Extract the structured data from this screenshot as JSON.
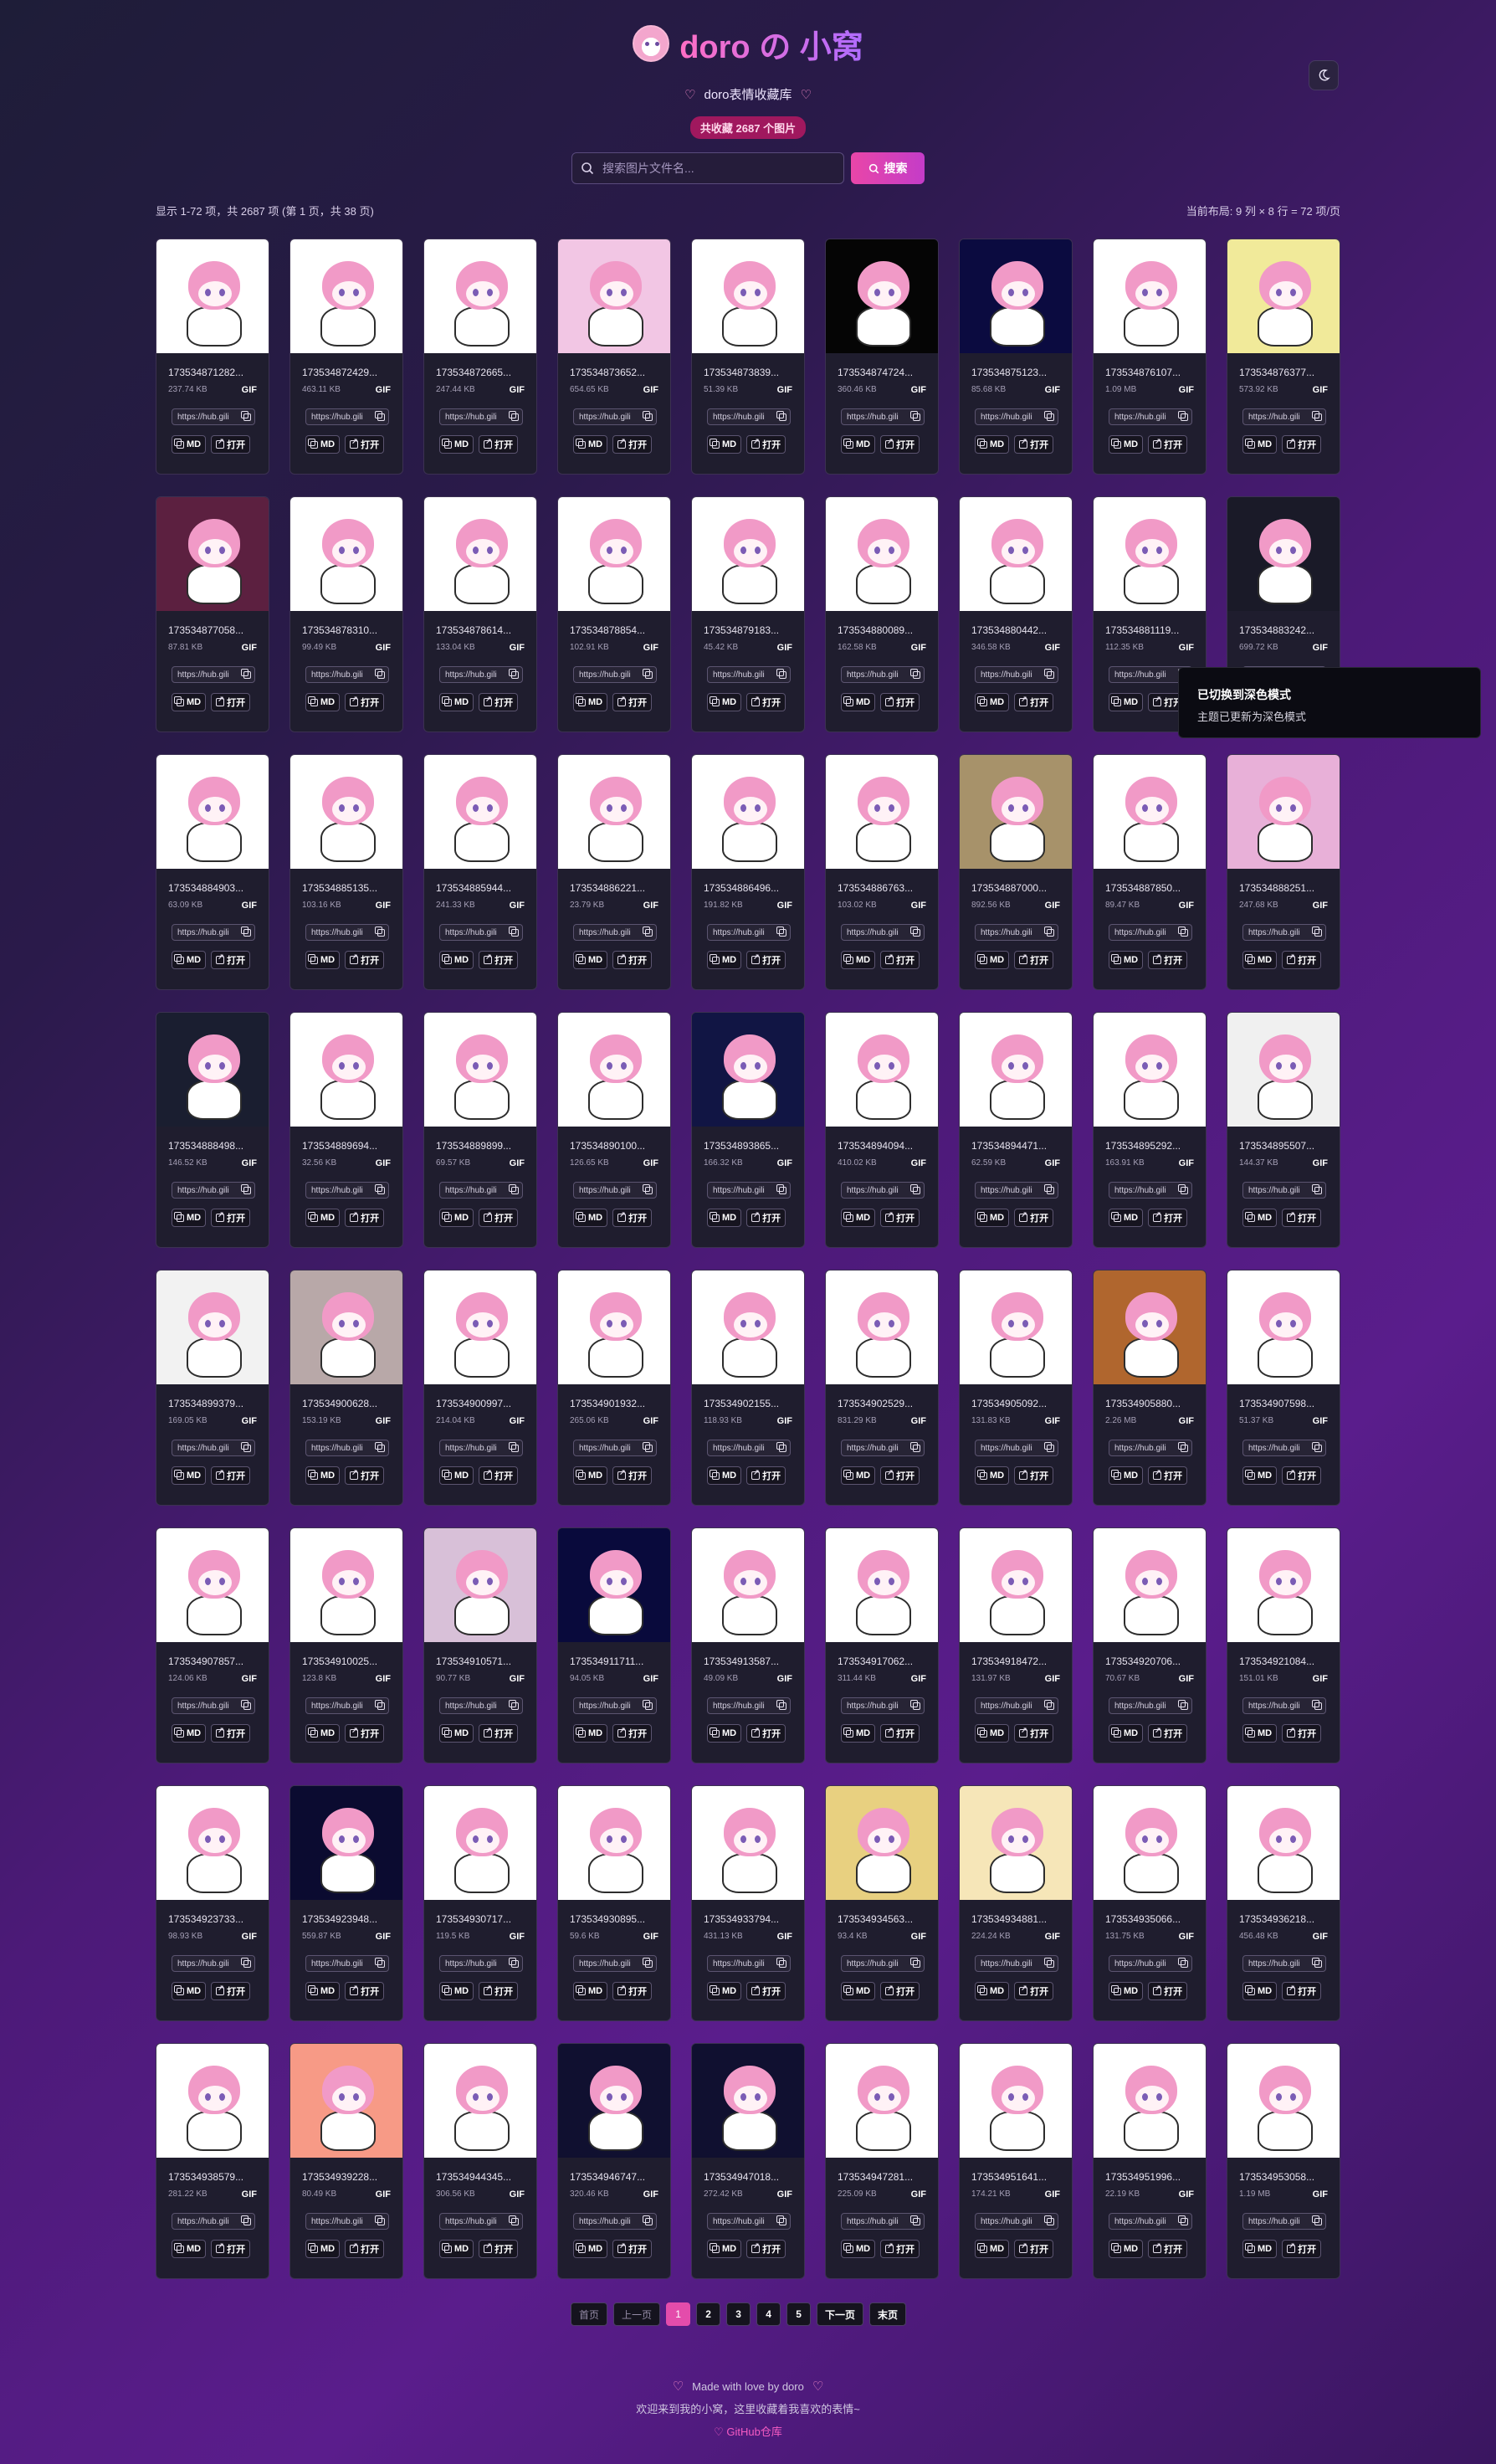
{
  "header": {
    "title": "doro の 小窝",
    "subtitle": "doro表情收藏库",
    "count_badge": "共收藏 2687 个图片"
  },
  "search": {
    "placeholder": "搜索图片文件名...",
    "button_label": "搜索"
  },
  "summary": {
    "left": "显示 1-72 项，共 2687 项 (第 1 页，共 38 页)",
    "right": "当前布局: 9 列 × 8 行 = 72 项/页"
  },
  "card_labels": {
    "url": "https://hub.gili",
    "md": "MD",
    "open": "打开",
    "format": "GIF"
  },
  "cards": [
    {
      "name": "173534871282...",
      "size": "237.74 KB",
      "bg": "#ffffff"
    },
    {
      "name": "173534872429...",
      "size": "463.11 KB",
      "bg": "#ffffff"
    },
    {
      "name": "173534872665...",
      "size": "247.44 KB",
      "bg": "#ffffff"
    },
    {
      "name": "173534873652...",
      "size": "654.65 KB",
      "bg": "#f2c6e4"
    },
    {
      "name": "173534873839...",
      "size": "51.39 KB",
      "bg": "#ffffff"
    },
    {
      "name": "173534874724...",
      "size": "360.46 KB",
      "bg": "#050505"
    },
    {
      "name": "173534875123...",
      "size": "85.68 KB",
      "bg": "#0b0b40"
    },
    {
      "name": "173534876107...",
      "size": "1.09 MB",
      "bg": "#ffffff"
    },
    {
      "name": "173534876377...",
      "size": "573.92 KB",
      "bg": "#f1ea9a"
    },
    {
      "name": "173534877058...",
      "size": "87.81 KB",
      "bg": "#5c2040"
    },
    {
      "name": "173534878310...",
      "size": "99.49 KB",
      "bg": "#ffffff"
    },
    {
      "name": "173534878614...",
      "size": "133.04 KB",
      "bg": "#ffffff"
    },
    {
      "name": "173534878854...",
      "size": "102.91 KB",
      "bg": "#ffffff"
    },
    {
      "name": "173534879183...",
      "size": "45.42 KB",
      "bg": "#ffffff"
    },
    {
      "name": "173534880089...",
      "size": "162.58 KB",
      "bg": "#ffffff"
    },
    {
      "name": "173534880442...",
      "size": "346.58 KB",
      "bg": "#ffffff"
    },
    {
      "name": "173534881119...",
      "size": "112.35 KB",
      "bg": "#ffffff"
    },
    {
      "name": "173534883242...",
      "size": "699.72 KB",
      "bg": "#1a1a28"
    },
    {
      "name": "173534884903...",
      "size": "63.09 KB",
      "bg": "#ffffff"
    },
    {
      "name": "173534885135...",
      "size": "103.16 KB",
      "bg": "#ffffff"
    },
    {
      "name": "173534885944...",
      "size": "241.33 KB",
      "bg": "#ffffff"
    },
    {
      "name": "173534886221...",
      "size": "23.79 KB",
      "bg": "#ffffff"
    },
    {
      "name": "173534886496...",
      "size": "191.82 KB",
      "bg": "#ffffff"
    },
    {
      "name": "173534886763...",
      "size": "103.02 KB",
      "bg": "#ffffff"
    },
    {
      "name": "173534887000...",
      "size": "892.56 KB",
      "bg": "#a7926a"
    },
    {
      "name": "173534887850...",
      "size": "89.47 KB",
      "bg": "#ffffff"
    },
    {
      "name": "173534888251...",
      "size": "247.68 KB",
      "bg": "#e8b0d8"
    },
    {
      "name": "173534888498...",
      "size": "146.52 KB",
      "bg": "#1a1e30"
    },
    {
      "name": "173534889694...",
      "size": "32.56 KB",
      "bg": "#ffffff"
    },
    {
      "name": "173534889899...",
      "size": "69.57 KB",
      "bg": "#ffffff"
    },
    {
      "name": "173534890100...",
      "size": "126.65 KB",
      "bg": "#ffffff"
    },
    {
      "name": "173534893865...",
      "size": "166.32 KB",
      "bg": "#111544"
    },
    {
      "name": "173534894094...",
      "size": "410.02 KB",
      "bg": "#ffffff"
    },
    {
      "name": "173534894471...",
      "size": "62.59 KB",
      "bg": "#ffffff"
    },
    {
      "name": "173534895292...",
      "size": "163.91 KB",
      "bg": "#ffffff"
    },
    {
      "name": "173534895507...",
      "size": "144.37 KB",
      "bg": "#f0f0f0"
    },
    {
      "name": "173534899379...",
      "size": "169.05 KB",
      "bg": "#f2f2f2"
    },
    {
      "name": "173534900628...",
      "size": "153.19 KB",
      "bg": "#b8a8a8"
    },
    {
      "name": "173534900997...",
      "size": "214.04 KB",
      "bg": "#ffffff"
    },
    {
      "name": "173534901932...",
      "size": "265.06 KB",
      "bg": "#ffffff"
    },
    {
      "name": "173534902155...",
      "size": "118.93 KB",
      "bg": "#ffffff"
    },
    {
      "name": "173534902529...",
      "size": "831.29 KB",
      "bg": "#ffffff"
    },
    {
      "name": "173534905092...",
      "size": "131.83 KB",
      "bg": "#ffffff"
    },
    {
      "name": "173534905880...",
      "size": "2.26 MB",
      "bg": "#b0662e"
    },
    {
      "name": "173534907598...",
      "size": "51.37 KB",
      "bg": "#ffffff"
    },
    {
      "name": "173534907857...",
      "size": "124.06 KB",
      "bg": "#ffffff"
    },
    {
      "name": "173534910025...",
      "size": "123.8 KB",
      "bg": "#ffffff"
    },
    {
      "name": "173534910571...",
      "size": "90.77 KB",
      "bg": "#d8c0d8"
    },
    {
      "name": "173534911711...",
      "size": "94.05 KB",
      "bg": "#090a3c"
    },
    {
      "name": "173534913587...",
      "size": "49.09 KB",
      "bg": "#ffffff"
    },
    {
      "name": "173534917062...",
      "size": "311.44 KB",
      "bg": "#ffffff"
    },
    {
      "name": "173534918472...",
      "size": "131.97 KB",
      "bg": "#ffffff"
    },
    {
      "name": "173534920706...",
      "size": "70.67 KB",
      "bg": "#ffffff"
    },
    {
      "name": "173534921084...",
      "size": "151.01 KB",
      "bg": "#ffffff"
    },
    {
      "name": "173534923733...",
      "size": "98.93 KB",
      "bg": "#ffffff"
    },
    {
      "name": "173534923948...",
      "size": "559.87 KB",
      "bg": "#0b0b30"
    },
    {
      "name": "173534930717...",
      "size": "119.5 KB",
      "bg": "#ffffff"
    },
    {
      "name": "173534930895...",
      "size": "59.6 KB",
      "bg": "#ffffff"
    },
    {
      "name": "173534933794...",
      "size": "431.13 KB",
      "bg": "#ffffff"
    },
    {
      "name": "173534934563...",
      "size": "93.4 KB",
      "bg": "#e8d080"
    },
    {
      "name": "173534934881...",
      "size": "224.24 KB",
      "bg": "#f6e6b8"
    },
    {
      "name": "173534935066...",
      "size": "131.75 KB",
      "bg": "#ffffff"
    },
    {
      "name": "173534936218...",
      "size": "456.48 KB",
      "bg": "#ffffff"
    },
    {
      "name": "173534938579...",
      "size": "281.22 KB",
      "bg": "#ffffff"
    },
    {
      "name": "173534939228...",
      "size": "80.49 KB",
      "bg": "#f79a86"
    },
    {
      "name": "173534944345...",
      "size": "306.56 KB",
      "bg": "#ffffff"
    },
    {
      "name": "173534946747...",
      "size": "320.46 KB",
      "bg": "#101030"
    },
    {
      "name": "173534947018...",
      "size": "272.42 KB",
      "bg": "#101030"
    },
    {
      "name": "173534947281...",
      "size": "225.09 KB",
      "bg": "#ffffff"
    },
    {
      "name": "173534951641...",
      "size": "174.21 KB",
      "bg": "#ffffff"
    },
    {
      "name": "173534951996...",
      "size": "22.19 KB",
      "bg": "#ffffff"
    },
    {
      "name": "173534953058...",
      "size": "1.19 MB",
      "bg": "#ffffff"
    }
  ],
  "toast": {
    "title": "已切换到深色模式",
    "message": "主题已更新为深色模式"
  },
  "pagination": {
    "first": "首页",
    "prev": "上一页",
    "pages": [
      "1",
      "2",
      "3",
      "4",
      "5"
    ],
    "next": "下一页",
    "last": "末页"
  },
  "footer": {
    "line1": "Made with love by doro",
    "line2": "欢迎来到我的小窝，这里收藏着我喜欢的表情~",
    "github": "GitHub仓库"
  },
  "colors": {
    "accent": "#e44cab",
    "card_bg": "#1f1d2e"
  }
}
